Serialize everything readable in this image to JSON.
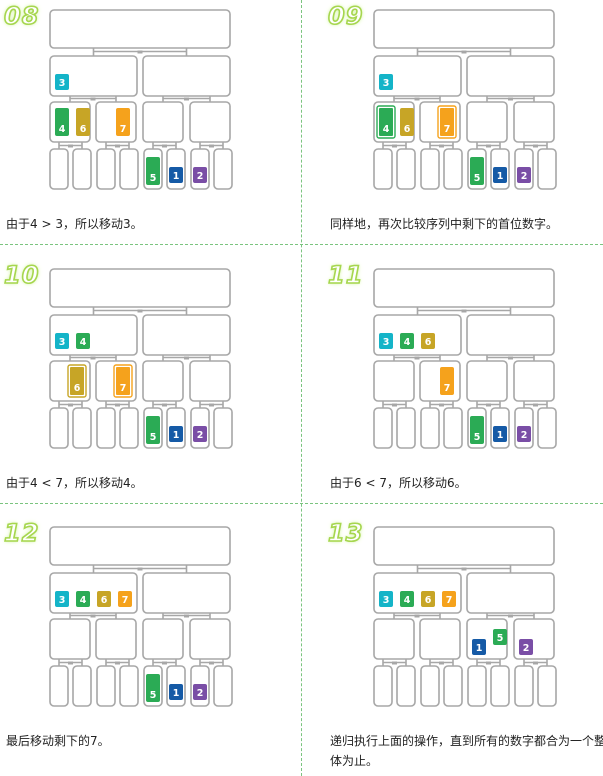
{
  "panels": [
    {
      "step": "08",
      "caption": "由于4 > 3，所以移动3。",
      "layout": {
        "row1": [
          {
            "v": "3",
            "c": "teal"
          }
        ],
        "row2": [
          [
            {
              "v": "4",
              "c": "green"
            },
            {
              "v": "6",
              "c": "olive"
            }
          ],
          [
            {
              "v": "7",
              "c": "orange"
            }
          ],
          [],
          []
        ],
        "leaves": [
          [],
          [],
          [],
          [],
          [
            {
              "v": "5",
              "c": "green"
            }
          ],
          [
            {
              "v": "1",
              "c": "blue"
            }
          ],
          [
            {
              "v": "2",
              "c": "purple"
            }
          ],
          []
        ],
        "highlight": []
      }
    },
    {
      "step": "09",
      "caption": "同样地，再次比较序列中剩下的首位数字。",
      "layout": {
        "row1": [
          {
            "v": "3",
            "c": "teal"
          }
        ],
        "row2": [
          [
            {
              "v": "4",
              "c": "green",
              "h": true
            },
            {
              "v": "6",
              "c": "olive"
            }
          ],
          [
            {
              "v": "7",
              "c": "orange",
              "h": true
            }
          ],
          [],
          []
        ],
        "leaves": [
          [],
          [],
          [],
          [],
          [
            {
              "v": "5",
              "c": "green"
            }
          ],
          [
            {
              "v": "1",
              "c": "blue"
            }
          ],
          [
            {
              "v": "2",
              "c": "purple"
            }
          ],
          []
        ]
      }
    },
    {
      "step": "10",
      "caption": "由于4 < 7，所以移动4。",
      "layout": {
        "row1": [
          {
            "v": "3",
            "c": "teal"
          },
          {
            "v": "4",
            "c": "green"
          }
        ],
        "row2": [
          [
            {
              "v": "6",
              "c": "olive",
              "h": true
            }
          ],
          [
            {
              "v": "7",
              "c": "orange",
              "h": true
            }
          ],
          [],
          []
        ],
        "leaves": [
          [],
          [],
          [],
          [],
          [
            {
              "v": "5",
              "c": "green"
            }
          ],
          [
            {
              "v": "1",
              "c": "blue"
            }
          ],
          [
            {
              "v": "2",
              "c": "purple"
            }
          ],
          []
        ]
      }
    },
    {
      "step": "11",
      "caption": "由于6 < 7，所以移动6。",
      "layout": {
        "row1": [
          {
            "v": "3",
            "c": "teal"
          },
          {
            "v": "4",
            "c": "green"
          },
          {
            "v": "6",
            "c": "olive"
          }
        ],
        "row2": [
          [],
          [
            {
              "v": "7",
              "c": "orange"
            }
          ],
          [],
          []
        ],
        "leaves": [
          [],
          [],
          [],
          [],
          [
            {
              "v": "5",
              "c": "green"
            }
          ],
          [
            {
              "v": "1",
              "c": "blue"
            }
          ],
          [
            {
              "v": "2",
              "c": "purple"
            }
          ],
          []
        ]
      }
    },
    {
      "step": "12",
      "caption": "最后移动剩下的7。",
      "layout": {
        "row1": [
          {
            "v": "3",
            "c": "teal"
          },
          {
            "v": "4",
            "c": "green"
          },
          {
            "v": "6",
            "c": "olive"
          },
          {
            "v": "7",
            "c": "orange"
          }
        ],
        "row2": [
          [],
          [],
          [],
          []
        ],
        "leaves": [
          [],
          [],
          [],
          [],
          [
            {
              "v": "5",
              "c": "green"
            }
          ],
          [
            {
              "v": "1",
              "c": "blue"
            }
          ],
          [
            {
              "v": "2",
              "c": "purple"
            }
          ],
          []
        ]
      }
    },
    {
      "step": "13",
      "caption": "递归执行上面的操作，直到所有的数字都合为一个整体为止。",
      "layout": {
        "row1": [
          {
            "v": "3",
            "c": "teal"
          },
          {
            "v": "4",
            "c": "green"
          },
          {
            "v": "6",
            "c": "olive"
          },
          {
            "v": "7",
            "c": "orange"
          }
        ],
        "row2": [
          [],
          [],
          [
            {
              "v": "1",
              "c": "blue"
            },
            {
              "v": "5",
              "c": "green"
            }
          ],
          [
            {
              "v": "2",
              "c": "purple"
            }
          ]
        ],
        "leaves": [
          [],
          [],
          [],
          [],
          [],
          [],
          [],
          []
        ]
      }
    }
  ],
  "colors": {
    "teal": "#14b4c8",
    "green": "#2bab55",
    "olive": "#c7a526",
    "orange": "#f5a21c",
    "blue": "#155aa6",
    "purple": "#7a4ea6",
    "box_border": "#a7a7a7",
    "line": "#a7a7a7"
  }
}
